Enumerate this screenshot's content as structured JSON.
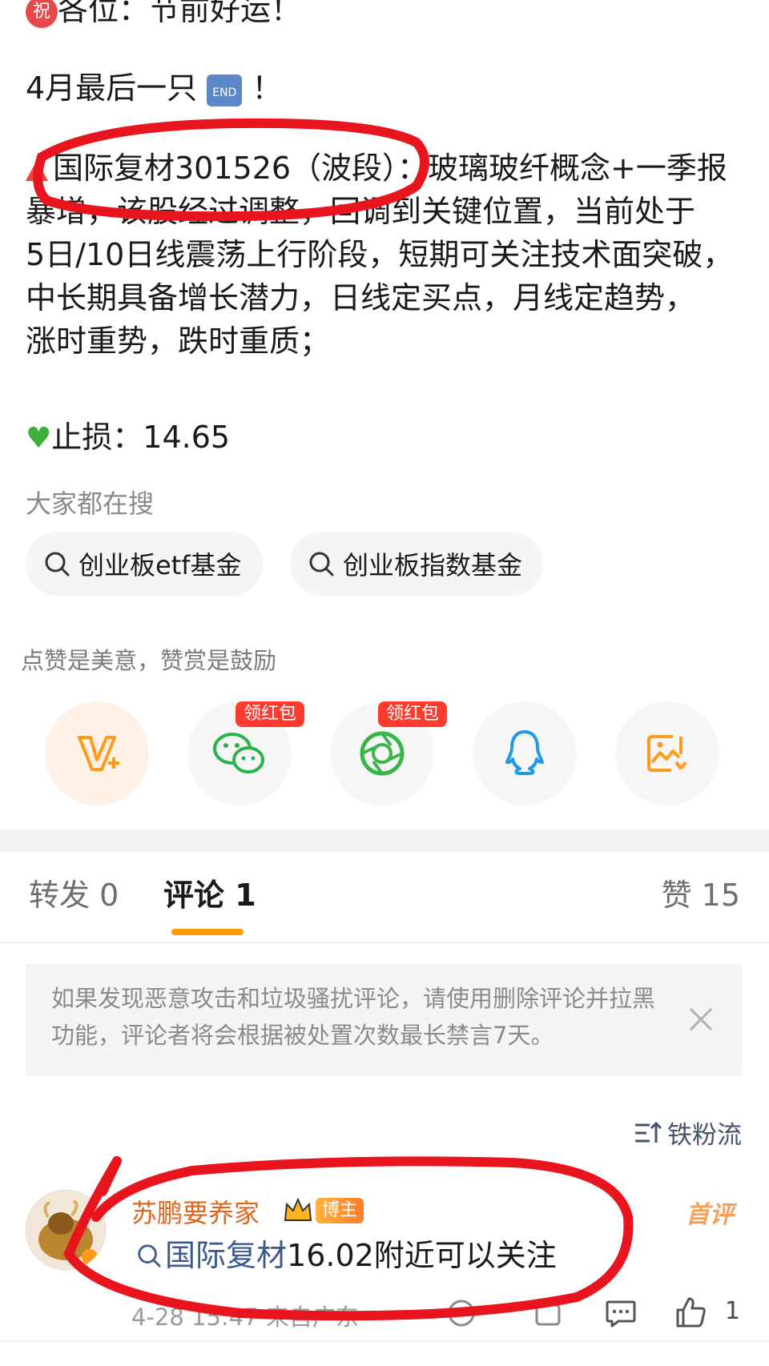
{
  "post": {
    "line1_badge": "祝",
    "line1_text": "各位：节前好运！",
    "line2_text": "4月最后一只",
    "line2_end_emoji": "END",
    "line2_suffix": "！",
    "stock_emoji": "🔺",
    "stock_line": "国际复材301526（波段）：玻璃玻纤概念+一季报",
    "body_lines": [
      "暴增，该股经过调整，回调到关键位置，当前处于",
      "5日/10日线震荡上行阶段，短期可关注技术面突破，",
      "中长期具备增长潜力，日线定买点，月线定趋势，",
      "涨时重势，跌时重质；"
    ],
    "stop_loss": "止损：14.65"
  },
  "search": {
    "label": "大家都在搜",
    "chips": [
      "创业板etf基金",
      "创业板指数基金"
    ]
  },
  "reward": {
    "hint": "点赞是美意，赞赏是鼓励",
    "redpack_label": "领红包"
  },
  "tabs": {
    "repost": "转发 0",
    "comment": "评论 1",
    "like": "赞 15"
  },
  "notice": {
    "text": "如果发现恶意攻击和垃圾骚扰评论，请使用删除评论并拉黑功能，评论者将会根据被处置次数最长禁言7天。"
  },
  "sort_label": "铁粉流",
  "comment": {
    "username": "苏鹏要养家",
    "badge": "博主",
    "first_tag": "首评",
    "link_text": "国际复材",
    "text": " 16.02附近可以关注",
    "meta": "4-28 15:47  来自广东",
    "like_count": "1"
  },
  "colors": {
    "accent": "#ff9a00",
    "username": "#e0651a",
    "link": "#3c5a8e",
    "annotation": "#e8141e"
  }
}
